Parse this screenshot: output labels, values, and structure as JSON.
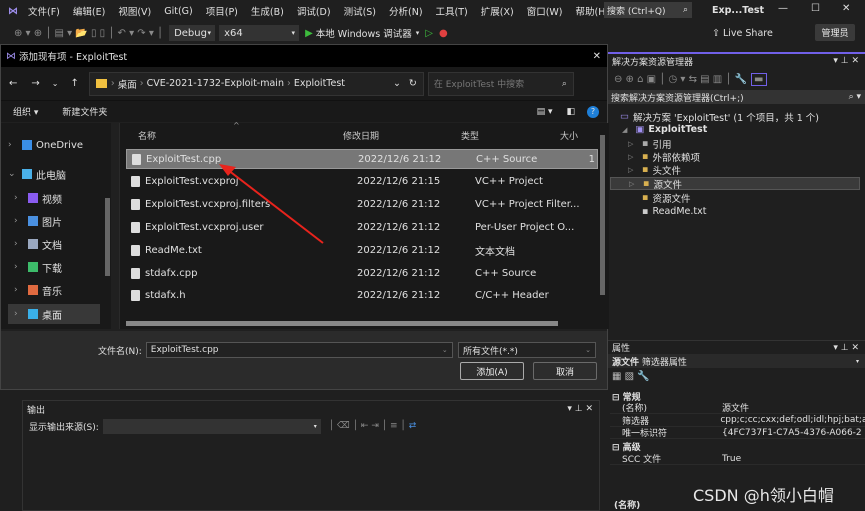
{
  "vs": {
    "menu": [
      "文件(F)",
      "编辑(E)",
      "视图(V)",
      "Git(G)",
      "项目(P)",
      "生成(B)",
      "调试(D)",
      "测试(S)",
      "分析(N)",
      "工具(T)",
      "扩展(X)",
      "窗口(W)",
      "帮助(H)"
    ],
    "search": "搜索 (Ctrl+Q)",
    "title": "Exp...Test",
    "config": "Debug",
    "platform": "x64",
    "run": "本地 Windows 调试器",
    "live_share": "Live Share",
    "admin": "管理员",
    "accent": "#7160e8"
  },
  "dialog": {
    "title": "添加现有项 - ExploitTest",
    "breadcrumb": [
      "桌面",
      "CVE-2021-1732-Exploit-main",
      "ExploitTest"
    ],
    "search_placeholder": "在 ExploitTest 中搜索",
    "organize": "组织",
    "new_folder": "新建文件夹",
    "nav": [
      "OneDrive",
      "此电脑",
      "视频",
      "图片",
      "文档",
      "下载",
      "音乐",
      "桌面"
    ],
    "columns": [
      "名称",
      "修改日期",
      "类型",
      "大小"
    ],
    "files": [
      {
        "name": "ExploitTest.cpp",
        "date": "2022/12/6 21:12",
        "type": "C++ Source",
        "size": "1"
      },
      {
        "name": "ExploitTest.vcxproj",
        "date": "2022/12/6 21:15",
        "type": "VC++ Project",
        "size": ""
      },
      {
        "name": "ExploitTest.vcxproj.filters",
        "date": "2022/12/6 21:12",
        "type": "VC++ Project Filter...",
        "size": ""
      },
      {
        "name": "ExploitTest.vcxproj.user",
        "date": "2022/12/6 21:12",
        "type": "Per-User Project O...",
        "size": ""
      },
      {
        "name": "ReadMe.txt",
        "date": "2022/12/6 21:12",
        "type": "文本文档",
        "size": ""
      },
      {
        "name": "stdafx.cpp",
        "date": "2022/12/6 21:12",
        "type": "C++ Source",
        "size": ""
      },
      {
        "name": "stdafx.h",
        "date": "2022/12/6 21:12",
        "type": "C/C++ Header",
        "size": ""
      }
    ],
    "filename_label": "文件名(N):",
    "filename": "ExploitTest.cpp",
    "filter": "所有文件(*.*)",
    "add": "添加(A)",
    "cancel": "取消"
  },
  "output": {
    "title": "输出",
    "source_label": "显示输出来源(S):"
  },
  "solution": {
    "title": "解决方案资源管理器",
    "search": "搜索解决方案资源管理器(Ctrl+;)",
    "root": "解决方案 'ExploitTest' (1 个项目，共 1 个)",
    "project": "ExploitTest",
    "items": [
      "引用",
      "外部依赖项",
      "头文件",
      "源文件",
      "资源文件",
      "ReadMe.txt"
    ]
  },
  "properties": {
    "title": "属性",
    "object": "源文件",
    "object_type": "筛选器属性",
    "cat1": "常规",
    "cat2": "高级",
    "rows": [
      {
        "k": "(名称)",
        "v": "源文件"
      },
      {
        "k": "筛选器",
        "v": "cpp;c;cc;cxx;def;odl;idl;hpj;bat;a"
      },
      {
        "k": "唯一标识符",
        "v": "{4FC737F1-C7A5-4376-A066-2"
      }
    ],
    "rows2": [
      {
        "k": "SCC 文件",
        "v": "True"
      }
    ],
    "desc": "(名称)"
  },
  "watermark": "CSDN @h领小白帽"
}
